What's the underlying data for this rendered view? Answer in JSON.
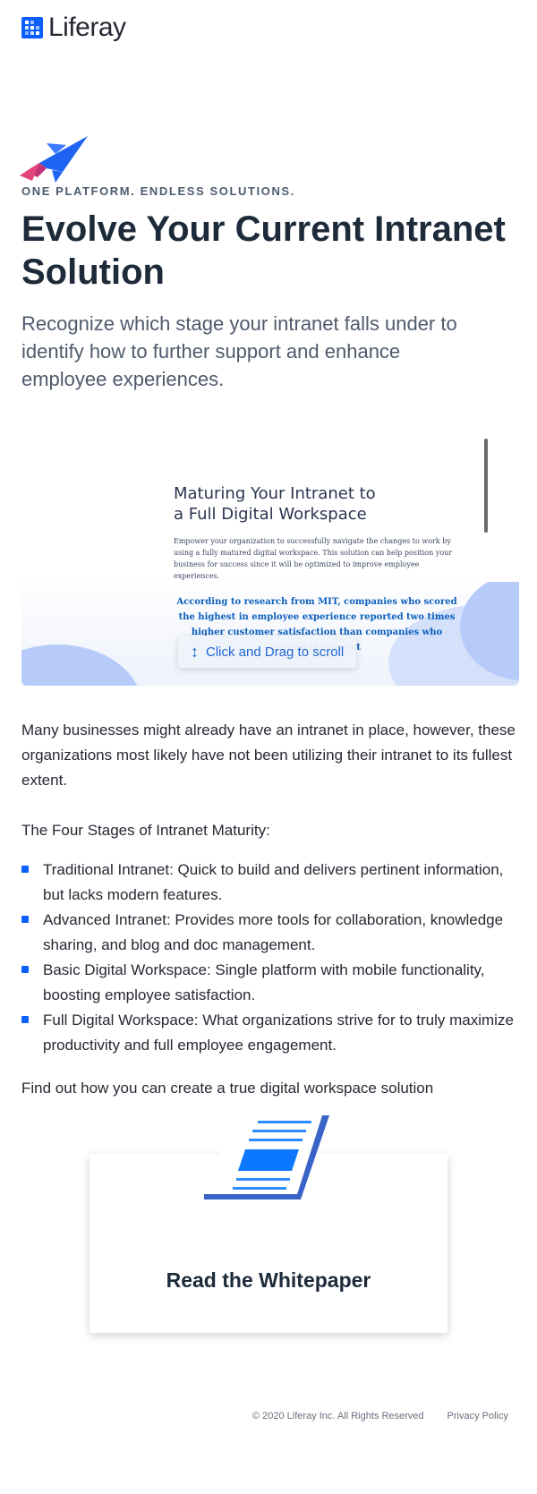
{
  "brand": {
    "logo_text": "Liferay",
    "logo_icon": "liferay-logo-icon",
    "accent": "#0b5fff"
  },
  "hero": {
    "icon": "rocket-illustration",
    "eyebrow": "ONE PLATFORM. ENDLESS SOLUTIONS.",
    "title": "Evolve Your Current Intranet Solution",
    "subtitle": "Recognize which stage your intranet falls under to identify how to further support and enhance employee experiences."
  },
  "preview": {
    "doc_title": "Maturing Your Intranet to a Full Digital Workspace",
    "doc_body": "Empower your organization to successfully navigate the changes to work by using a fully matured digital workspace. This solution can help position your business for success since it will be optimized to improve employee experiences.",
    "doc_quote": "According to research from MIT, companies who scored the highest in employee experience reported two times higher customer satisfaction than companies who scored the lowest",
    "drag_icon": "vertical-arrows-icon",
    "drag_label": "Click and Drag to scroll"
  },
  "content": {
    "intro": "Many businesses might already have an intranet in place, however, these organizations most likely have not been utilizing their intranet to its fullest extent.",
    "stages_heading": "The Four Stages of Intranet Maturity:",
    "stages": [
      "Traditional Intranet: Quick to build and delivers pertinent information, but lacks modern features.",
      "Advanced Intranet: Provides more tools for collaboration, knowledge sharing, and blog and doc management.",
      "Basic Digital Workspace: Single platform with mobile functionality, boosting employee satisfaction.",
      "Full Digital Workspace: What organizations strive for to truly maximize productivity and full employee engagement."
    ],
    "closing": "Find out how you can create a true digital workspace solution"
  },
  "cta": {
    "icon": "document-illustration",
    "label": "Read the Whitepaper"
  },
  "footer": {
    "copyright": "© 2020 Liferay Inc. All Rights Reserved",
    "privacy": "Privacy Policy"
  }
}
